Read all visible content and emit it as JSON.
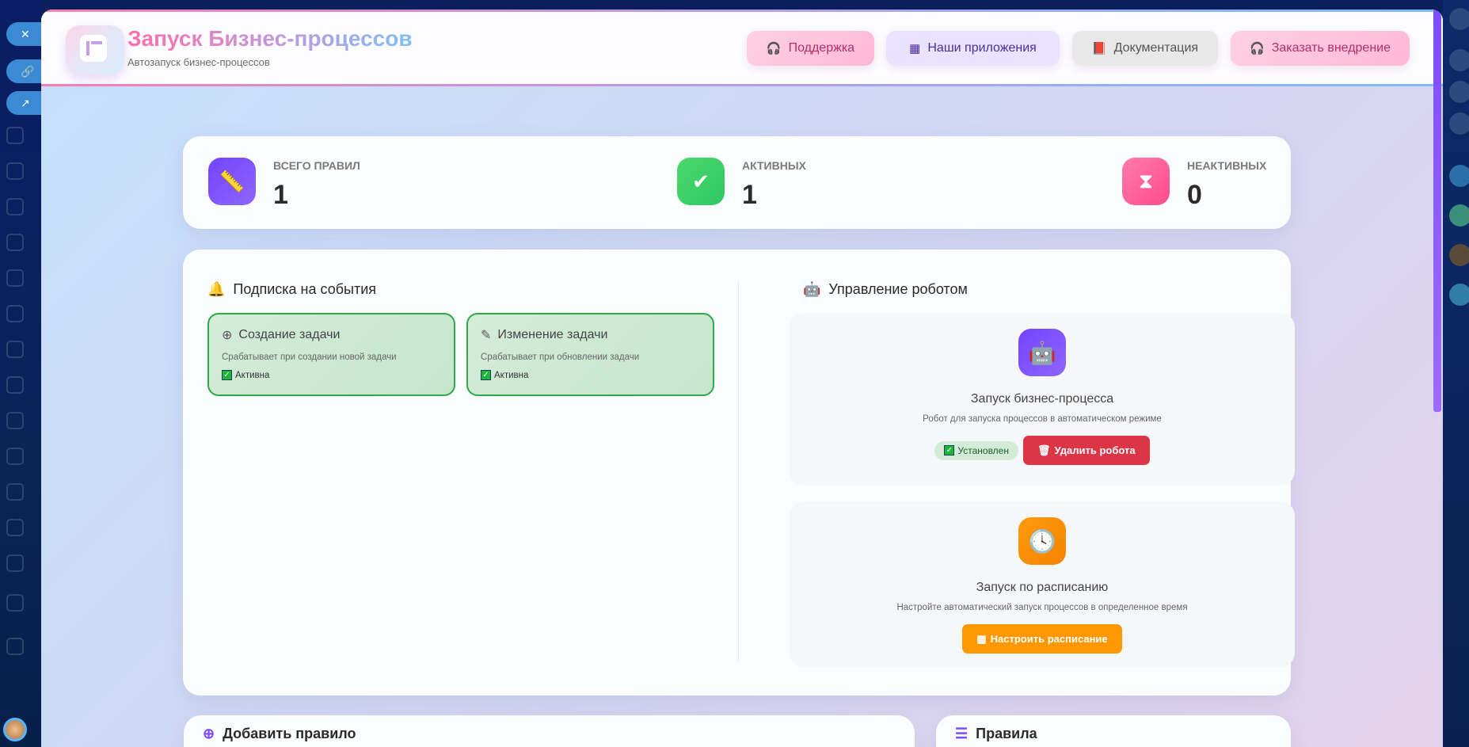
{
  "app": {
    "title": "Запуск Бизнес-процессов",
    "subtitle": "Автозапуск бизнес-процессов"
  },
  "header_buttons": [
    {
      "label": "Поддержка",
      "icon": "headset-icon"
    },
    {
      "label": "Наши приложения",
      "icon": "grid-icon"
    },
    {
      "label": "Документация",
      "icon": "book-icon"
    },
    {
      "label": "Заказать внедрение",
      "icon": "headset-icon"
    }
  ],
  "stats": [
    {
      "label": "ВСЕГО ПРАВИЛ",
      "value": "1",
      "icon": "ruler-icon",
      "color": "#7c4dff"
    },
    {
      "label": "АКТИВНЫХ",
      "value": "1",
      "icon": "check-circle-icon",
      "color": "#3ccf6a"
    },
    {
      "label": "НЕАКТИВНЫХ",
      "value": "0",
      "icon": "hourglass-icon",
      "color": "#ff5c97"
    }
  ],
  "events": {
    "title": "Подписка на события",
    "items": [
      {
        "title": "Создание задачи",
        "desc": "Срабатывает при создании новой задачи",
        "status": "Активна"
      },
      {
        "title": "Изменение задачи",
        "desc": "Срабатывает при обновлении задачи",
        "status": "Активна"
      }
    ]
  },
  "robot": {
    "title": "Управление роботом",
    "bp": {
      "title": "Запуск бизнес-процесса",
      "desc": "Робот для запуска процессов в автоматическом режиме",
      "status": "Установлен",
      "delete_label": "Удалить робота"
    },
    "schedule": {
      "title": "Запуск по расписанию",
      "desc": "Настройте автоматический запуск процессов в определенное время",
      "button_label": "Настроить расписание"
    }
  },
  "bottom": {
    "add_rule": "Добавить правило",
    "rules": "Правила"
  },
  "colors": {
    "purple": "#7c4dff",
    "green": "#2fa84a",
    "red": "#dc3545",
    "orange": "#ff9800"
  }
}
